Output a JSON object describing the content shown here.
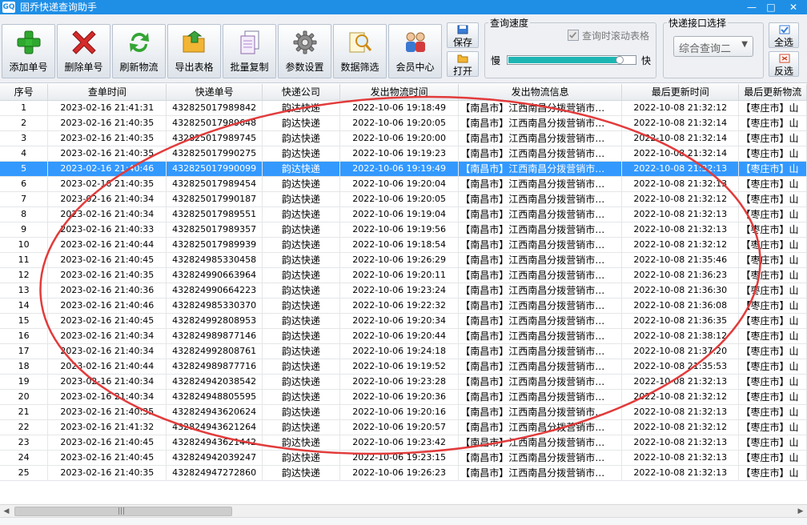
{
  "window": {
    "title": "固乔快递查询助手",
    "icon_text": "GQ",
    "minimize": "—",
    "maximize": "□",
    "close": "✕"
  },
  "toolbar": {
    "add": "添加单号",
    "delete": "删除单号",
    "refresh": "刷新物流",
    "export": "导出表格",
    "batch_copy": "批量复制",
    "settings": "参数设置",
    "filter": "数据筛选",
    "member": "会员中心",
    "save": "保存",
    "open": "打开",
    "select_all": "全选",
    "invert": "反选"
  },
  "speed": {
    "title": "查询速度",
    "scroll_label": "查询时滚动表格",
    "scroll_checked": true,
    "slow": "慢",
    "fast": "快",
    "level": 0.88
  },
  "api": {
    "title": "快递接口选择",
    "selected": "综合查询二"
  },
  "table": {
    "headers": [
      "序号",
      "查单时间",
      "快递单号",
      "快递公司",
      "发出物流时间",
      "发出物流信息",
      "最后更新时间",
      "最后更新物流"
    ],
    "selected_index": 4,
    "rows": [
      [
        "1",
        "2023-02-16 21:41:31",
        "432825017989842",
        "韵达快递",
        "2022-10-06 19:18:49",
        "【南昌市】江西南昌分拨营销市…",
        "2022-10-08 21:32:12",
        "【枣庄市】山"
      ],
      [
        "2",
        "2023-02-16 21:40:35",
        "432825017989648",
        "韵达快递",
        "2022-10-06 19:20:05",
        "【南昌市】江西南昌分拨营销市…",
        "2022-10-08 21:32:14",
        "【枣庄市】山"
      ],
      [
        "3",
        "2023-02-16 21:40:35",
        "432825017989745",
        "韵达快递",
        "2022-10-06 19:20:00",
        "【南昌市】江西南昌分拨营销市…",
        "2022-10-08 21:32:14",
        "【枣庄市】山"
      ],
      [
        "4",
        "2023-02-16 21:40:35",
        "432825017990275",
        "韵达快递",
        "2022-10-06 19:19:23",
        "【南昌市】江西南昌分拨营销市…",
        "2022-10-08 21:32:14",
        "【枣庄市】山"
      ],
      [
        "5",
        "2023-02-16 21:40:46",
        "432825017990099",
        "韵达快递",
        "2022-10-06 19:19:49",
        "【南昌市】江西南昌分拨营销市…",
        "2022-10-08 21:32:13",
        "【枣庄市】山"
      ],
      [
        "6",
        "2023-02-16 21:40:35",
        "432825017989454",
        "韵达快递",
        "2022-10-06 19:20:04",
        "【南昌市】江西南昌分拨营销市…",
        "2022-10-08 21:32:13",
        "【枣庄市】山"
      ],
      [
        "7",
        "2023-02-16 21:40:34",
        "432825017990187",
        "韵达快递",
        "2022-10-06 19:20:05",
        "【南昌市】江西南昌分拨营销市…",
        "2022-10-08 21:32:12",
        "【枣庄市】山"
      ],
      [
        "8",
        "2023-02-16 21:40:34",
        "432825017989551",
        "韵达快递",
        "2022-10-06 19:19:04",
        "【南昌市】江西南昌分拨营销市…",
        "2022-10-08 21:32:13",
        "【枣庄市】山"
      ],
      [
        "9",
        "2023-02-16 21:40:33",
        "432825017989357",
        "韵达快递",
        "2022-10-06 19:19:56",
        "【南昌市】江西南昌分拨营销市…",
        "2022-10-08 21:32:13",
        "【枣庄市】山"
      ],
      [
        "10",
        "2023-02-16 21:40:44",
        "432825017989939",
        "韵达快递",
        "2022-10-06 19:18:54",
        "【南昌市】江西南昌分拨营销市…",
        "2022-10-08 21:32:12",
        "【枣庄市】山"
      ],
      [
        "11",
        "2023-02-16 21:40:45",
        "432824985330458",
        "韵达快递",
        "2022-10-06 19:26:29",
        "【南昌市】江西南昌分拨营销市…",
        "2022-10-08 21:35:46",
        "【枣庄市】山"
      ],
      [
        "12",
        "2023-02-16 21:40:35",
        "432824990663964",
        "韵达快递",
        "2022-10-06 19:20:11",
        "【南昌市】江西南昌分拨营销市…",
        "2022-10-08 21:36:23",
        "【枣庄市】山"
      ],
      [
        "13",
        "2023-02-16 21:40:36",
        "432824990664223",
        "韵达快递",
        "2022-10-06 19:23:24",
        "【南昌市】江西南昌分拨营销市…",
        "2022-10-08 21:36:30",
        "【枣庄市】山"
      ],
      [
        "14",
        "2023-02-16 21:40:46",
        "432824985330370",
        "韵达快递",
        "2022-10-06 19:22:32",
        "【南昌市】江西南昌分拨营销市…",
        "2022-10-08 21:36:08",
        "【枣庄市】山"
      ],
      [
        "15",
        "2023-02-16 21:40:45",
        "432824992808953",
        "韵达快递",
        "2022-10-06 19:20:34",
        "【南昌市】江西南昌分拨营销市…",
        "2022-10-08 21:36:35",
        "【枣庄市】山"
      ],
      [
        "16",
        "2023-02-16 21:40:34",
        "432824989877146",
        "韵达快递",
        "2022-10-06 19:20:44",
        "【南昌市】江西南昌分拨营销市…",
        "2022-10-08 21:38:12",
        "【枣庄市】山"
      ],
      [
        "17",
        "2023-02-16 21:40:34",
        "432824992808761",
        "韵达快递",
        "2022-10-06 19:24:18",
        "【南昌市】江西南昌分拨营销市…",
        "2022-10-08 21:37:20",
        "【枣庄市】山"
      ],
      [
        "18",
        "2023-02-16 21:40:44",
        "432824989877716",
        "韵达快递",
        "2022-10-06 19:19:52",
        "【南昌市】江西南昌分拨营销市…",
        "2022-10-08 21:35:53",
        "【枣庄市】山"
      ],
      [
        "19",
        "2023-02-16 21:40:34",
        "432824942038542",
        "韵达快递",
        "2022-10-06 19:23:28",
        "【南昌市】江西南昌分拨营销市…",
        "2022-10-08 21:32:13",
        "【枣庄市】山"
      ],
      [
        "20",
        "2023-02-16 21:40:34",
        "432824948805595",
        "韵达快递",
        "2022-10-06 19:20:36",
        "【南昌市】江西南昌分拨营销市…",
        "2022-10-08 21:32:12",
        "【枣庄市】山"
      ],
      [
        "21",
        "2023-02-16 21:40:35",
        "432824943620624",
        "韵达快递",
        "2022-10-06 19:20:16",
        "【南昌市】江西南昌分拨营销市…",
        "2022-10-08 21:32:13",
        "【枣庄市】山"
      ],
      [
        "22",
        "2023-02-16 21:41:32",
        "432824943621264",
        "韵达快递",
        "2022-10-06 19:20:57",
        "【南昌市】江西南昌分拨营销市…",
        "2022-10-08 21:32:12",
        "【枣庄市】山"
      ],
      [
        "23",
        "2023-02-16 21:40:45",
        "432824943621442",
        "韵达快递",
        "2022-10-06 19:23:42",
        "【南昌市】江西南昌分拨营销市…",
        "2022-10-08 21:32:13",
        "【枣庄市】山"
      ],
      [
        "24",
        "2023-02-16 21:40:45",
        "432824942039247",
        "韵达快递",
        "2022-10-06 19:23:15",
        "【南昌市】江西南昌分拨营销市…",
        "2022-10-08 21:32:13",
        "【枣庄市】山"
      ],
      [
        "25",
        "2023-02-16 21:40:35",
        "432824947272860",
        "韵达快递",
        "2022-10-06 19:26:23",
        "【南昌市】江西南昌分拨营销市…",
        "2022-10-08 21:32:13",
        "【枣庄市】山"
      ]
    ]
  },
  "scrollbar": {
    "left_arrow": "◀",
    "right_arrow": "▶",
    "grip": "|||"
  },
  "colors": {
    "titlebar": "#1f8fe6",
    "selection": "#3399ff",
    "speed_fill": "#1cb5b2",
    "annotation": "#e23b3b"
  }
}
